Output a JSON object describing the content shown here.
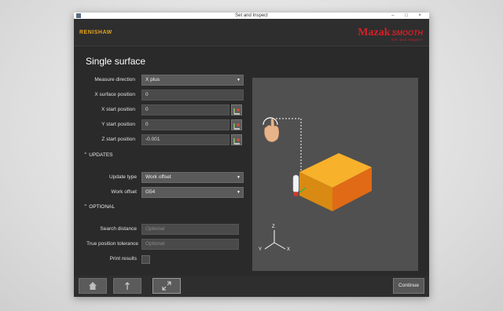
{
  "window": {
    "title": "Set and Inspect",
    "controls": "– □ ×"
  },
  "brand": {
    "renishaw": "RENISHAW",
    "mazak": "Mazak",
    "smooth": "SMOOTH",
    "smooth_sub": "Set and Inspect"
  },
  "page": {
    "title": "Single surface"
  },
  "form": {
    "measure_direction": {
      "label": "Measure direction",
      "value": "X plus"
    },
    "x_surface_position": {
      "label": "X surface position",
      "value": "0"
    },
    "x_start_position": {
      "label": "X start position",
      "value": "0"
    },
    "y_start_position": {
      "label": "Y start position",
      "value": "0"
    },
    "z_start_position": {
      "label": "Z start position",
      "value": "-0.001"
    }
  },
  "updates": {
    "header": "UPDATES",
    "update_type": {
      "label": "Update type",
      "value": "Work offset"
    },
    "work_offset": {
      "label": "Work offset",
      "value": "G54"
    }
  },
  "optional": {
    "header": "OPTIONAL",
    "search_distance": {
      "label": "Search distance",
      "placeholder": "Optional"
    },
    "true_position_tolerance": {
      "label": "True position tolerance",
      "placeholder": "Optional"
    },
    "print_results": {
      "label": "Print results",
      "checked": false
    }
  },
  "illustration": {
    "axis_z": "Z",
    "axis_y": "Y",
    "axis_x": "X",
    "block_color": "#f5a623"
  },
  "footer": {
    "continue_label": "Continue"
  },
  "icons": {
    "home": "home-icon",
    "up": "arrow-up-icon",
    "minimize": "collapse-icon"
  }
}
